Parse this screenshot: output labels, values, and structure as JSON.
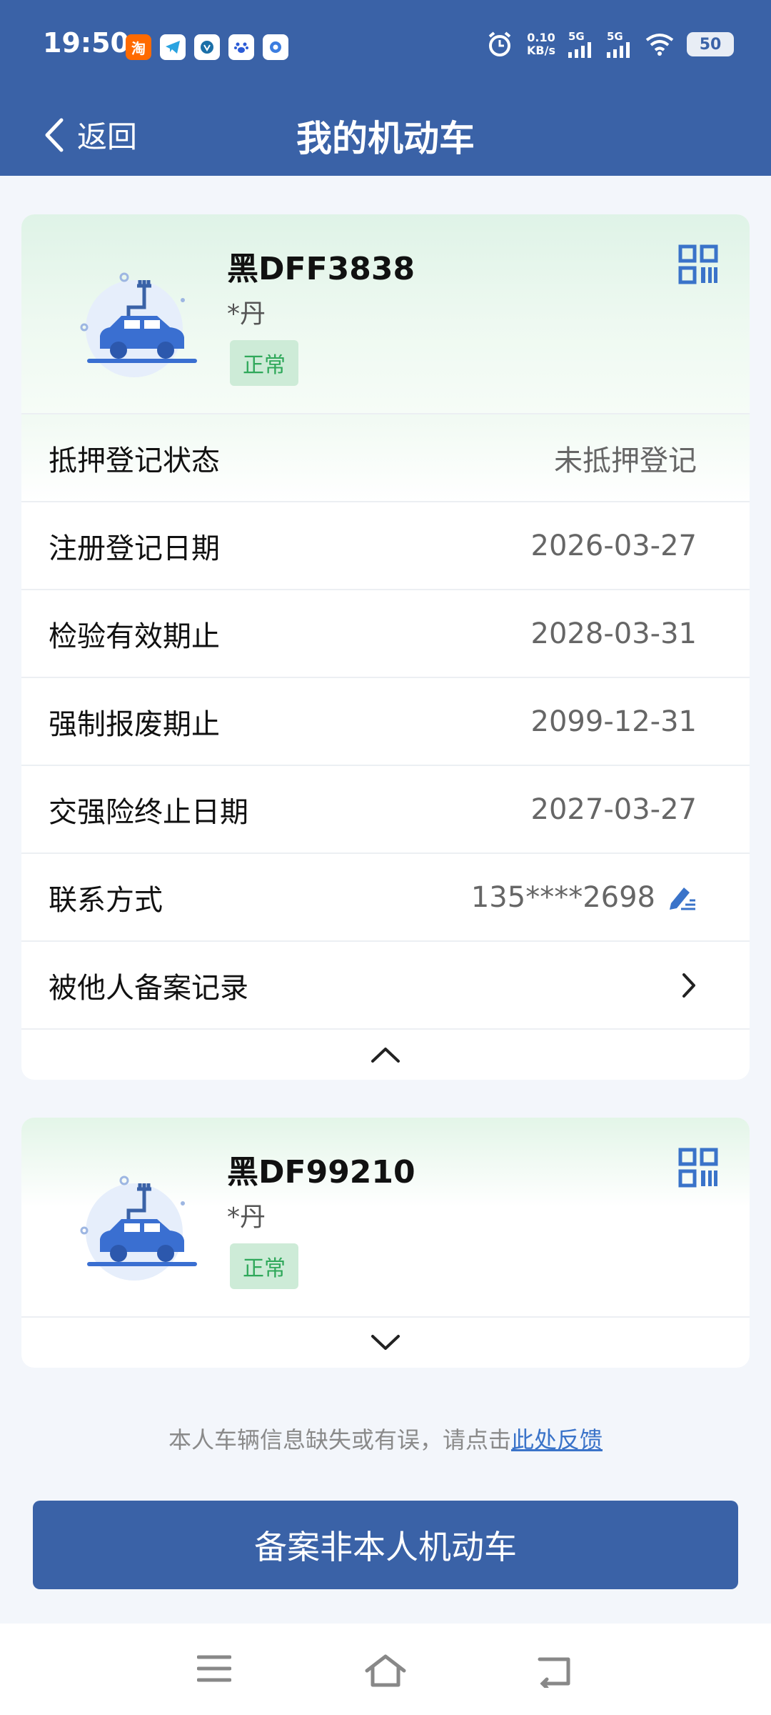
{
  "status_bar": {
    "time": "19:50",
    "notif_icons": [
      "taobao-icon",
      "telegram-icon",
      "app-icon",
      "baidu-icon",
      "app2-icon"
    ],
    "notif_texts": [
      "淘",
      "",
      "",
      "",
      ""
    ],
    "net_speed_value": "0.10",
    "net_speed_unit": "KB/s",
    "sig1_label": "5G",
    "sig2_label": "5G",
    "battery": "50"
  },
  "nav": {
    "back_label": "返回",
    "title": "我的机动车"
  },
  "vehicles": [
    {
      "plate": "黑DFF3838",
      "owner": "*丹",
      "status": "正常",
      "rows": [
        {
          "label": "抵押登记状态",
          "value": "未抵押登记"
        },
        {
          "label": "注册登记日期",
          "value": "2026-03-27"
        },
        {
          "label": "检验有效期止",
          "value": "2028-03-31"
        },
        {
          "label": "强制报废期止",
          "value": "2099-12-31"
        },
        {
          "label": "交强险终止日期",
          "value": "2027-03-27"
        },
        {
          "label": "联系方式",
          "value": "135****2698"
        },
        {
          "label": "被他人备案记录",
          "value": ""
        }
      ]
    },
    {
      "plate": "黑DF99210",
      "owner": "*丹",
      "status": "正常"
    }
  ],
  "feedback": {
    "text": "本人车辆信息缺失或有误，请点击",
    "link": "此处反馈"
  },
  "primary_button": "备案非本人机动车",
  "colors": {
    "brand": "#3a62a7",
    "status_green": "#2fa85a",
    "link": "#3a73c9"
  }
}
